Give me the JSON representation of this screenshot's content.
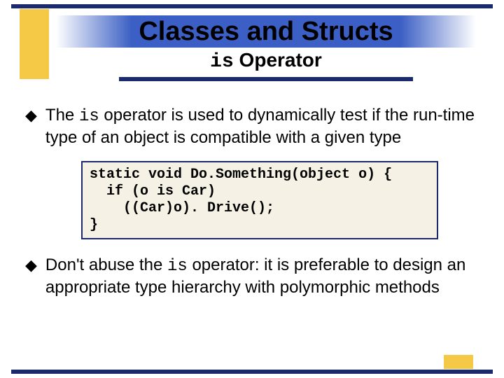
{
  "title": "Classes and Structs",
  "subtitle_mono": "is",
  "subtitle_rest": " Operator",
  "bullets": [
    {
      "pre": "The ",
      "mono": "is",
      "post": " operator is used to dynamically test if the run-time type of an object is compatible with a given type"
    },
    {
      "pre": "Don't abuse the ",
      "mono": "is",
      "post": " operator: it is preferable to design an appropriate type hierarchy with polymorphic methods"
    }
  ],
  "code": "static void Do.Something(object o) {\n  if (o is Car)\n    ((Car)o). Drive();\n}"
}
